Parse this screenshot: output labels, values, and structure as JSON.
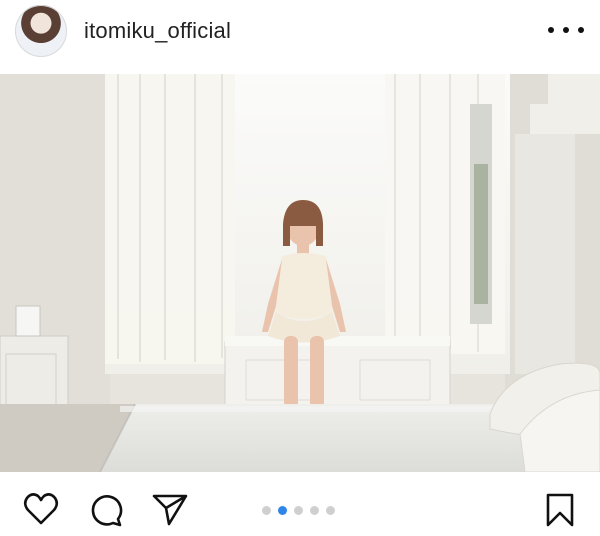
{
  "post": {
    "username": "itomiku_official",
    "image_description": "",
    "carousel": {
      "total": 5,
      "active_index": 1
    }
  },
  "colors": {
    "active_dot": "#2f86e8",
    "inactive_dot": "#cfcfcf",
    "text": "#222222"
  },
  "icons": {
    "avatar": "profile-avatar",
    "more": "more-options-icon",
    "like": "heart-icon",
    "comment": "comment-bubble-icon",
    "share": "paper-plane-icon",
    "save": "bookmark-icon"
  }
}
